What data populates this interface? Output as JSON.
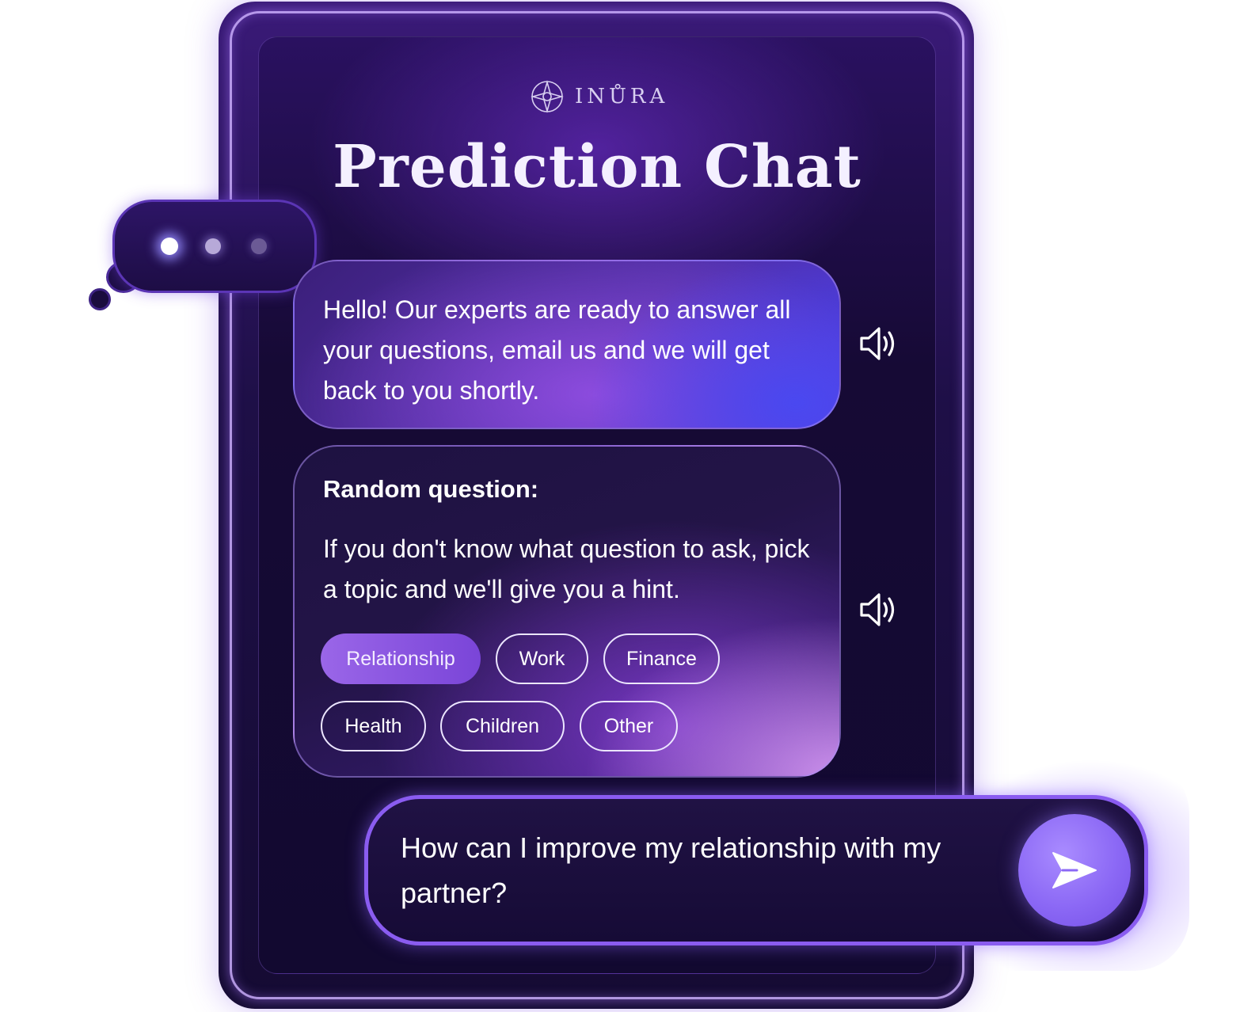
{
  "brand": {
    "name": "INŮRA"
  },
  "title": "Prediction Chat",
  "typing_indicator": {
    "icon": "typing-dots-icon"
  },
  "messages": {
    "greeting": {
      "text": "Hello! Our experts are ready to answer all your questions, email us and we will get back to you shortly.",
      "speaker_icon": "speaker-icon"
    },
    "random_question": {
      "heading": "Random question:",
      "body": "If you don't know what question to ask, pick a topic and we'll give you a hint.",
      "speaker_icon": "speaker-icon",
      "topics": [
        {
          "label": "Relationship",
          "selected": true
        },
        {
          "label": "Work",
          "selected": false
        },
        {
          "label": "Finance",
          "selected": false
        },
        {
          "label": "Health",
          "selected": false
        },
        {
          "label": "Children",
          "selected": false
        },
        {
          "label": "Other",
          "selected": false
        }
      ]
    }
  },
  "composer": {
    "value": "How can I improve my relationship with my partner?",
    "send_icon": "send-icon"
  },
  "colors": {
    "accent": "#8a5cf0",
    "chip_active": "#9a66e8",
    "background_dark": "#160a35"
  }
}
